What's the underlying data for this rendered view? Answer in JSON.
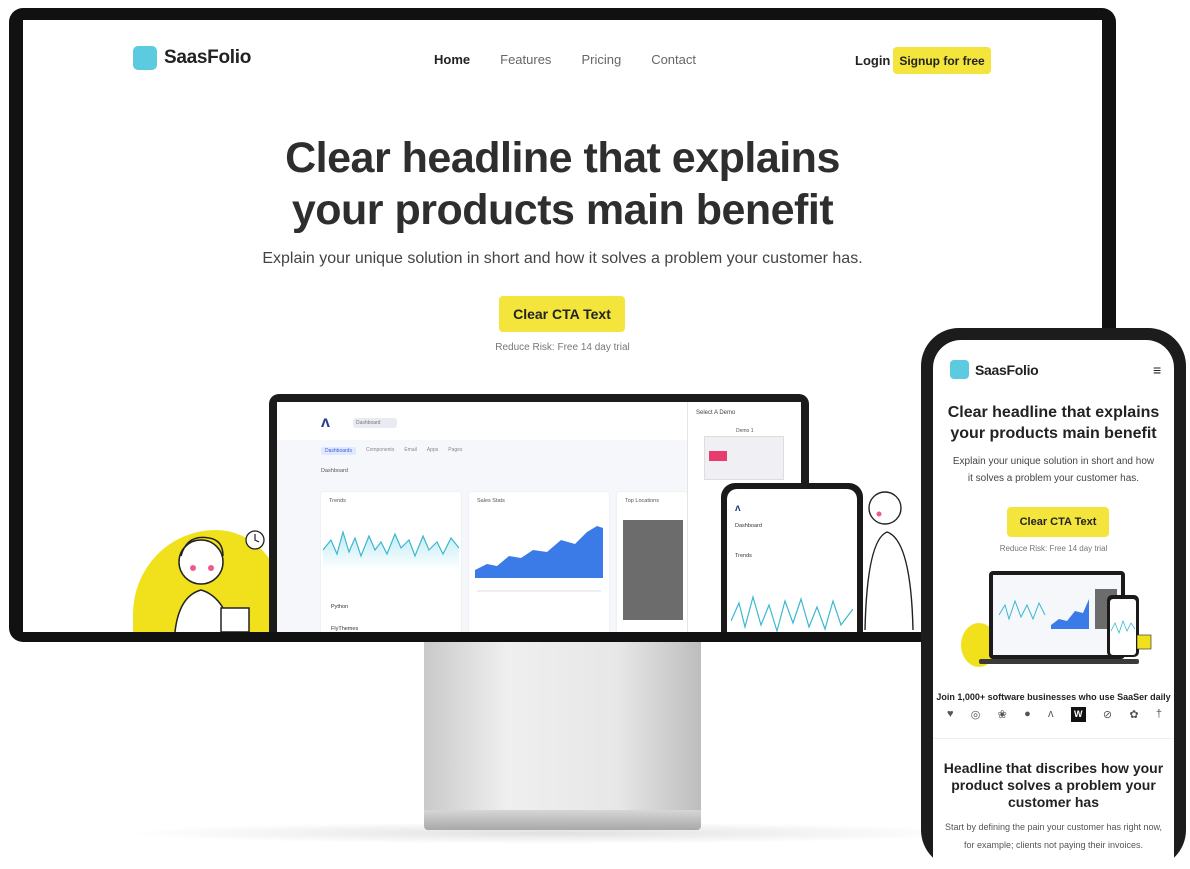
{
  "brand": {
    "name": "SaasFolio",
    "color": "#5ccbdf",
    "accent": "#f3e53b"
  },
  "desktop": {
    "nav": {
      "links": [
        "Home",
        "Features",
        "Pricing",
        "Contact"
      ],
      "active": "Home",
      "login": "Login",
      "signup": "Signup for free"
    },
    "hero": {
      "title_line1": "Clear headline that explains",
      "title_line2": "your products main benefit",
      "subtitle": "Explain your unique solution in short and how it solves a problem your customer has.",
      "cta": "Clear CTA Text",
      "risk": "Reduce Risk: Free 14 day trial"
    },
    "dashboard": {
      "logo": "ʌ",
      "select": "Dashboard",
      "tabs": [
        "Dashboards",
        "Components",
        "Email",
        "Apps",
        "Pages"
      ],
      "breadcrumb": "Dashboard",
      "cards": [
        "Trends",
        "Sales Stats",
        "Top Locations"
      ],
      "list": [
        "Python",
        "FlyThemes"
      ],
      "demo_title": "Select A Demo",
      "demo_label": "Demo 1"
    }
  },
  "mobile": {
    "menu_icon": "≡",
    "title": "Clear headline that explains your products main benefit",
    "subtitle": "Explain your unique solution in short and how it solves a problem your customer has.",
    "cta": "Clear CTA Text",
    "risk": "Reduce Risk: Free 14 day trial",
    "join": "Join 1,000+ software businesses who use SaaSer daily",
    "logo_glyphs": [
      "♥",
      "◎",
      "❀",
      "●",
      "ʌ",
      "W",
      "⊘",
      "✿",
      "†"
    ],
    "headline2": "Headline that discribes how your product solves a problem your customer has",
    "body": "Start by defining the pain your customer has right now, for example; clients not paying their invoices."
  }
}
